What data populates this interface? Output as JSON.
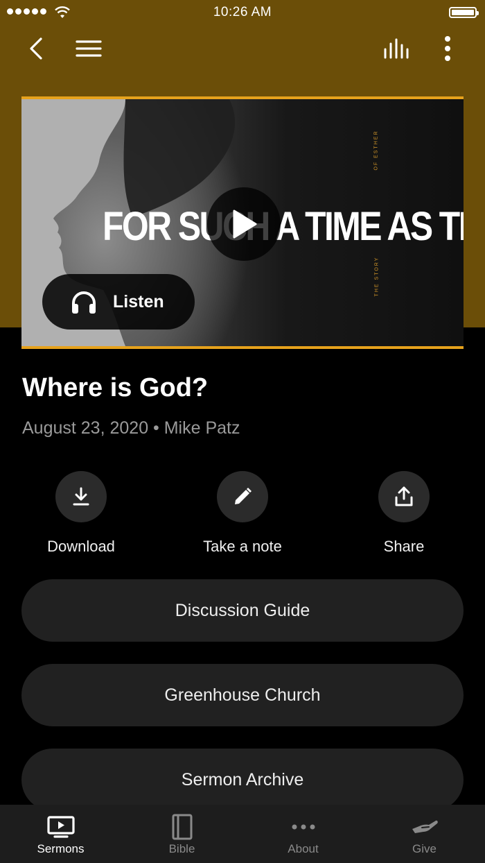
{
  "status_bar": {
    "time": "10:26 AM"
  },
  "hero": {
    "title": "FOR SUCH A TIME AS THIS",
    "side_text_top": "OF ESTHER",
    "side_text_bottom": "THE STORY",
    "listen_label": "Listen",
    "accent_color": "#e6a21c",
    "header_color": "#6b4e08"
  },
  "sermon": {
    "title": "Where is God?",
    "meta": "August 23, 2020 • Mike Patz"
  },
  "actions": [
    {
      "label": "Download",
      "icon": "download-icon"
    },
    {
      "label": "Take a note",
      "icon": "pencil-icon"
    },
    {
      "label": "Share",
      "icon": "share-icon"
    }
  ],
  "links": [
    {
      "label": "Discussion Guide"
    },
    {
      "label": "Greenhouse Church"
    },
    {
      "label": "Sermon Archive"
    }
  ],
  "tabs": [
    {
      "label": "Sermons",
      "icon": "tv-play-icon",
      "active": true
    },
    {
      "label": "Bible",
      "icon": "book-icon",
      "active": false
    },
    {
      "label": "About",
      "icon": "dots-icon",
      "active": false
    },
    {
      "label": "Give",
      "icon": "give-hand-icon",
      "active": false
    }
  ]
}
